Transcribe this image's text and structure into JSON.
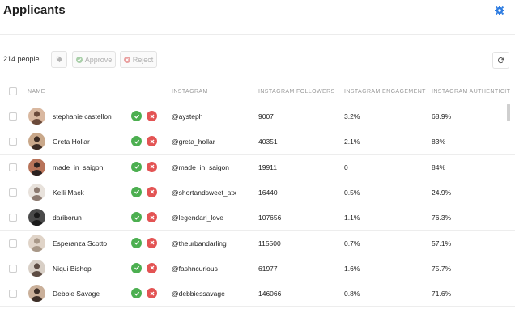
{
  "header": {
    "title": "Applicants"
  },
  "toolbar": {
    "count": "214 people",
    "approve_label": "Approve",
    "reject_label": "Reject"
  },
  "columns": [
    "NAME",
    "INSTAGRAM",
    "INSTAGRAM FOLLOWERS",
    "INSTAGRAM ENGAGEMENT",
    "INSTAGRAM AUTHENTICITY"
  ],
  "rows": [
    {
      "name": "stephanie castellon",
      "instagram": "@aysteph",
      "followers": "9007",
      "engagement": "3.2%",
      "authenticity": "68.9%"
    },
    {
      "name": "Greta Hollar",
      "instagram": "@greta_hollar",
      "followers": "40351",
      "engagement": "2.1%",
      "authenticity": "83%"
    },
    {
      "name": "made_in_saigon",
      "instagram": "@made_in_saigon",
      "followers": "19911",
      "engagement": "0",
      "authenticity": "84%"
    },
    {
      "name": "Kelli Mack",
      "instagram": "@shortandsweet_atx",
      "followers": "16440",
      "engagement": "0.5%",
      "authenticity": "24.9%"
    },
    {
      "name": "dariborun",
      "instagram": "@legendari_love",
      "followers": "107656",
      "engagement": "1.1%",
      "authenticity": "76.3%"
    },
    {
      "name": "Esperanza Scotto",
      "instagram": "@theurbandarling",
      "followers": "115500",
      "engagement": "0.7%",
      "authenticity": "57.1%"
    },
    {
      "name": "Niqui Bishop",
      "instagram": "@fashncurious",
      "followers": "61977",
      "engagement": "1.6%",
      "authenticity": "75.7%"
    },
    {
      "name": "Debbie Savage",
      "instagram": "@debbiessavage",
      "followers": "146066",
      "engagement": "0.8%",
      "authenticity": "71.6%"
    }
  ],
  "colors": {
    "approve": "#4caf50",
    "reject": "#e35454",
    "gear": "#2f7de1"
  },
  "icons": {
    "settings": "gear-icon",
    "tag": "tag-icon",
    "approve": "check-icon",
    "reject": "close-icon",
    "refresh": "refresh-icon"
  }
}
